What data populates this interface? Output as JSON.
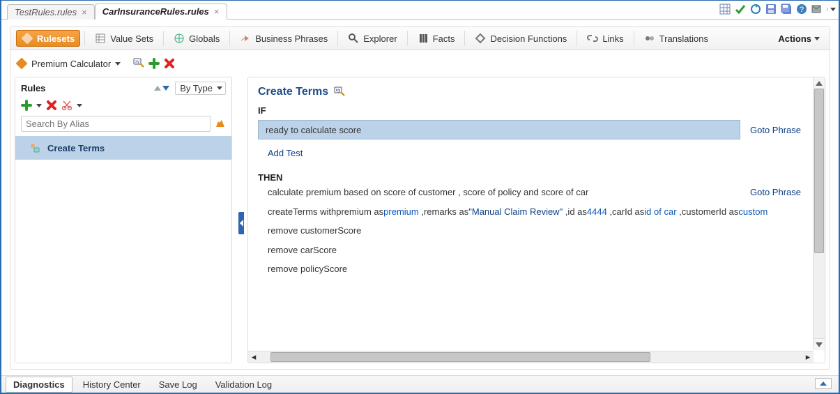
{
  "tabs": [
    {
      "label": "TestRules.rules",
      "active": false
    },
    {
      "label": "CarInsuranceRules.rules",
      "active": true
    }
  ],
  "primary_bar": {
    "items": [
      {
        "label": "Rulesets",
        "icon": "rulesets",
        "active": true
      },
      {
        "label": "Value Sets",
        "icon": "valuesets"
      },
      {
        "label": "Globals",
        "icon": "globals"
      },
      {
        "label": "Business Phrases",
        "icon": "phrases"
      },
      {
        "label": "Explorer",
        "icon": "explorer"
      },
      {
        "label": "Facts",
        "icon": "facts"
      },
      {
        "label": "Decision Functions",
        "icon": "decisionfn"
      },
      {
        "label": "Links",
        "icon": "links"
      },
      {
        "label": "Translations",
        "icon": "translations"
      }
    ],
    "actions_label": "Actions"
  },
  "secondary_bar": {
    "ruleset_label": "Premium Calculator"
  },
  "left_panel": {
    "title": "Rules",
    "sort_label": "By Type",
    "search_placeholder": "Search By Alias",
    "rows": [
      {
        "label": "Create Terms",
        "selected": true
      }
    ]
  },
  "rule_editor": {
    "title": "Create Terms",
    "if_label": "IF",
    "if_condition": "ready to calculate score",
    "goto_label": "Goto Phrase",
    "add_test": "Add Test",
    "then_label": "THEN",
    "then_lines": {
      "line1": "calculate premium based on score of customer , score of policy and score of car",
      "line2": {
        "p1": "createTerms withpremium as",
        "p2": "premium",
        "p3": " ,remarks as",
        "p4": "\"Manual Claim Review\"",
        "p5": " ,id as",
        "p6": "4444",
        "p7": " ,carId as",
        "p8": "id of car",
        "p9": " ,customerId as",
        "p10": "custom"
      },
      "line3": "remove customerScore",
      "line4": "remove carScore",
      "line5": "remove policyScore"
    }
  },
  "bottom_tabs": [
    {
      "label": "Diagnostics",
      "active": true
    },
    {
      "label": "History Center"
    },
    {
      "label": "Save Log"
    },
    {
      "label": "Validation Log"
    }
  ]
}
